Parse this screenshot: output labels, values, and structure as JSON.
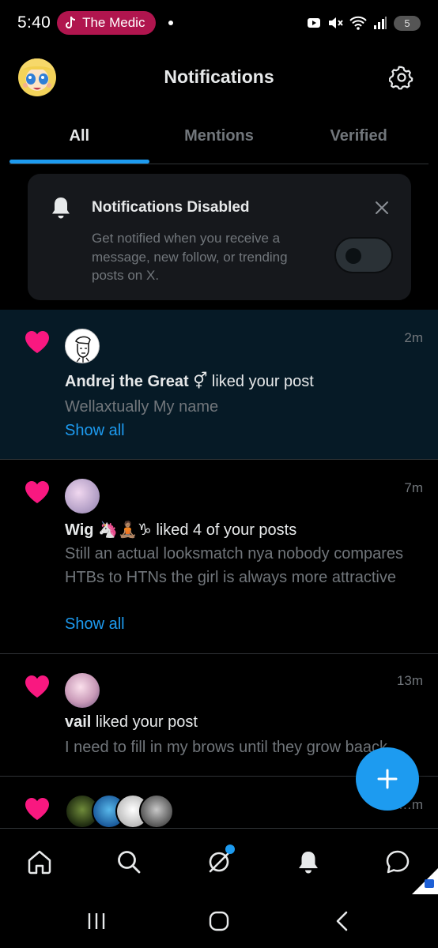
{
  "status_bar": {
    "time": "5:40",
    "media_label": "The Medic",
    "battery": "5"
  },
  "header": {
    "title": "Notifications"
  },
  "tabs": [
    {
      "label": "All",
      "active": true
    },
    {
      "label": "Mentions",
      "active": false
    },
    {
      "label": "Verified",
      "active": false
    }
  ],
  "banner": {
    "title": "Notifications Disabled",
    "text": "Get notified when you receive a message, new follow, or trending posts on X.",
    "toggle_on": false
  },
  "notifications": [
    {
      "user": "Andrej the Great",
      "user_emoji": "⚥",
      "action": " liked your post",
      "snippet": "Wellaxtually My name",
      "show_all": "Show all",
      "time": "2m",
      "unread": true
    },
    {
      "user": "Wig",
      "user_emoji": "🦄🧘🏽♑",
      "action": " liked 4 of your posts",
      "snippet": "Still an actual looksmatch nya  nobody compares HTBs to HTNs the girl is always more attractive",
      "show_all": "Show all",
      "time": "7m",
      "unread": false
    },
    {
      "user": "vail",
      "user_emoji": "",
      "action": " liked your post",
      "snippet": "I need to fill in my brows until they grow baack",
      "time": "13m",
      "unread": false
    },
    {
      "time": "…m",
      "unread": false
    }
  ],
  "bottom_nav": [
    "home-icon",
    "search-icon",
    "grok-icon",
    "notifications-bell-icon",
    "messages-icon"
  ],
  "colors": {
    "accent": "#1d9bf0",
    "like": "#f91880",
    "background": "#000000",
    "muted_text": "#71767b"
  }
}
